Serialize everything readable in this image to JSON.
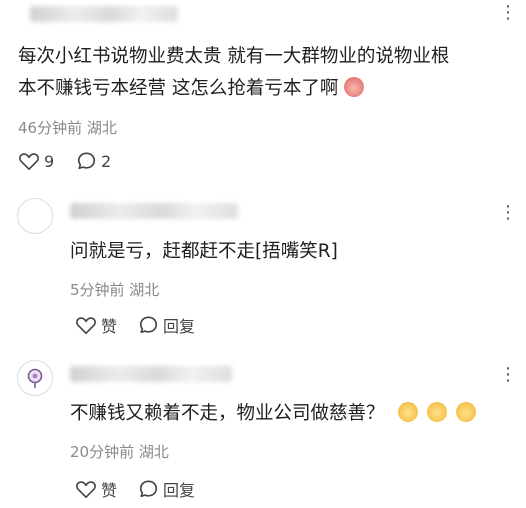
{
  "comments": [
    {
      "text_line1": "每次小红书说物业费太贵 就有一大群物业的说物业根",
      "text_line2": "本不赚钱亏本经营 这怎么抢着亏本了啊",
      "meta": "46分钟前 湖北",
      "like_count": "9",
      "reply_count": "2"
    }
  ],
  "replies": [
    {
      "text": "问就是亏，赶都赶不走[捂嘴笑R]",
      "meta": "5分钟前 湖北",
      "like_label": "赞",
      "reply_label": "回复"
    },
    {
      "text": "不赚钱又赖着不走，物业公司做慈善？",
      "meta": "20分钟前 湖北",
      "like_label": "赞",
      "reply_label": "回复"
    }
  ],
  "icons": {
    "more": "more-dots-icon",
    "like": "heart-icon",
    "comment": "comment-bubble-icon",
    "peach_emoji": "peach-emoji",
    "laugh_emoji": "laughing-emoji"
  }
}
